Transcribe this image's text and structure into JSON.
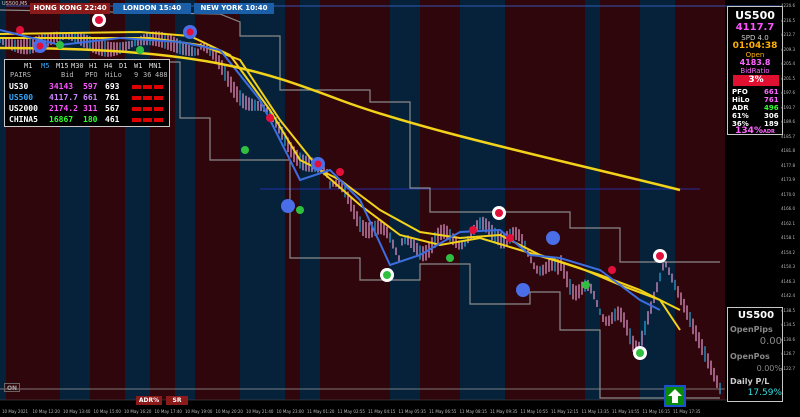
{
  "window": {
    "title": "US500,M5"
  },
  "sessions": [
    {
      "label": "HONG KONG  22:40",
      "bg": "#8b1a1a"
    },
    {
      "label": "LONDON  15:40",
      "bg": "#1a5fa8"
    },
    {
      "label": "NEW YORK  10:40",
      "bg": "#1a5fa8"
    }
  ],
  "pairs_panel": {
    "timeframes": [
      "M1",
      "M5",
      "M15",
      "M30",
      "H1",
      "H4",
      "D1",
      "W1",
      "MN1"
    ],
    "header": {
      "pairs": "PAIRS",
      "bid": "Bid",
      "pfo": "PFO",
      "hilo": "HiLo",
      "n1": "9",
      "n2": "36",
      "n3": "488"
    },
    "rows": [
      {
        "pair": "US30",
        "bid": "34143",
        "pfo": "597",
        "hilo": "693",
        "color": "#ff55ff"
      },
      {
        "pair": "US500",
        "bid": "4117.7",
        "pfo": "661",
        "hilo": "761",
        "color": "#cc88ff"
      },
      {
        "pair": "US2000",
        "bid": "2174.2",
        "pfo": "311",
        "hilo": "567",
        "color": "#ff55ff"
      },
      {
        "pair": "CHINA5",
        "bid": "16867",
        "pfo": "180",
        "hilo": "461",
        "color": "#33ff33"
      }
    ]
  },
  "side_panel": {
    "symbol": "US500",
    "price": "4117.7",
    "spread": "SPD 4.0",
    "timer": "01:04:38",
    "open_label": "Open",
    "open_value": "4183.8",
    "bidratio_label": "BidRatio",
    "bidratio_value": "3%",
    "stats": [
      {
        "k": "PFO",
        "v": "661",
        "c": "#ff66ff"
      },
      {
        "k": "HiLo",
        "v": "761",
        "c": "#ff66ff"
      },
      {
        "k": "ADR",
        "v": "496",
        "c": "#33ff33"
      },
      {
        "k": "61%",
        "v": "306",
        "c": "#ffffff"
      },
      {
        "k": "36%",
        "v": "189",
        "c": "#ffffff"
      }
    ],
    "adr_pct": "134%",
    "adr_suffix": "ADR"
  },
  "pl_panel": {
    "symbol": "US500",
    "open_pips_label": "OpenPips",
    "open_pips_value": "0.00",
    "open_pos_label": "OpenPos",
    "open_pos_value": "0.00%",
    "daily_pl_label": "Daily P/L",
    "daily_pl_value": "17.59%"
  },
  "buttons": {
    "on": "ON",
    "adr": "ADR%",
    "sr": "SR"
  },
  "price_axis": [
    "4220.6",
    "4216.5",
    "4212.7",
    "4209.3",
    "4205.4",
    "4201.5",
    "4197.6",
    "4193.7",
    "4189.6",
    "4185.7",
    "4181.8",
    "4177.8",
    "4173.9",
    "4170.0",
    "4166.0",
    "4162.1",
    "4158.1",
    "4154.2",
    "4150.3",
    "4146.3",
    "4142.4",
    "4138.5",
    "4134.5",
    "4130.6",
    "4126.7",
    "4122.7"
  ],
  "time_axis": [
    "10 May 2021",
    "10 May 12:20",
    "10 May 13:40",
    "10 May 15:00",
    "10 May 16:20",
    "10 May 17:40",
    "10 May 19:00",
    "10 May 20:20",
    "10 May 21:40",
    "10 May 23:00",
    "11 May 01:20",
    "11 May 02:55",
    "11 May 04:15",
    "11 May 05:35",
    "11 May 06:55",
    "11 May 08:15",
    "11 May 09:35",
    "11 May 10:55",
    "11 May 12:15",
    "11 May 13:35",
    "11 May 14:55",
    "11 May 16:15",
    "11 May 17:35"
  ],
  "colors": {
    "bg": "#000000",
    "red_zone": "#2e060c",
    "blue_zone": "#06223a",
    "yellow": "#f2d21b",
    "blue_ma": "#3c6ee0",
    "gray_band": "#8a8a8a"
  }
}
